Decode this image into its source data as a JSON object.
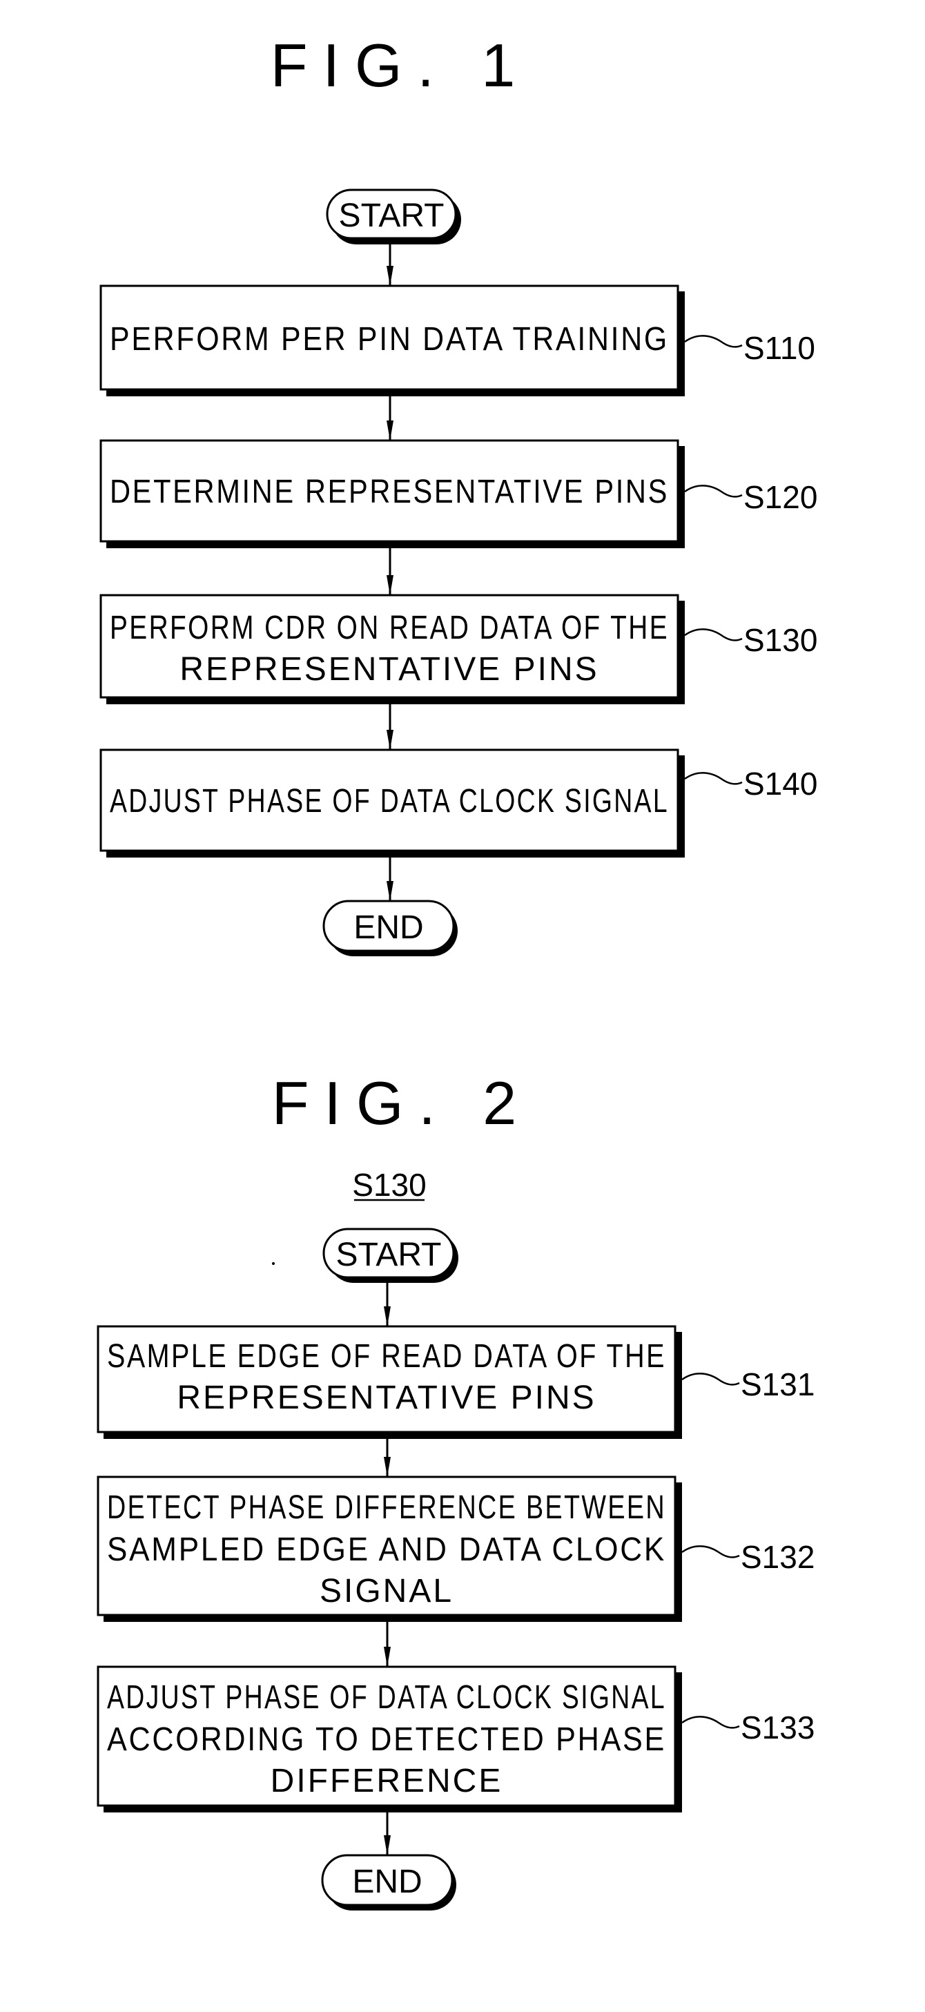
{
  "figures": [
    {
      "title": "FIG. 1",
      "subtitle": "",
      "start_label": "START",
      "end_label": "END",
      "steps": [
        {
          "id": "S110",
          "lines": [
            "PERFORM PER PIN DATA TRAINING"
          ]
        },
        {
          "id": "S120",
          "lines": [
            "DETERMINE REPRESENTATIVE PINS"
          ]
        },
        {
          "id": "S130",
          "lines": [
            "PERFORM CDR ON READ DATA OF THE",
            "REPRESENTATIVE PINS"
          ]
        },
        {
          "id": "S140",
          "lines": [
            "ADJUST PHASE OF DATA CLOCK SIGNAL"
          ]
        }
      ]
    },
    {
      "title": "FIG. 2",
      "subtitle": "S130",
      "start_label": "START",
      "end_label": "END",
      "steps": [
        {
          "id": "S131",
          "lines": [
            "SAMPLE EDGE OF READ DATA OF THE",
            "REPRESENTATIVE PINS"
          ]
        },
        {
          "id": "S132",
          "lines": [
            "DETECT PHASE DIFFERENCE BETWEEN",
            "SAMPLED EDGE AND DATA CLOCK",
            "SIGNAL"
          ]
        },
        {
          "id": "S133",
          "lines": [
            "ADJUST PHASE OF DATA CLOCK SIGNAL",
            "ACCORDING TO DETECTED PHASE",
            "DIFFERENCE"
          ]
        }
      ]
    }
  ]
}
